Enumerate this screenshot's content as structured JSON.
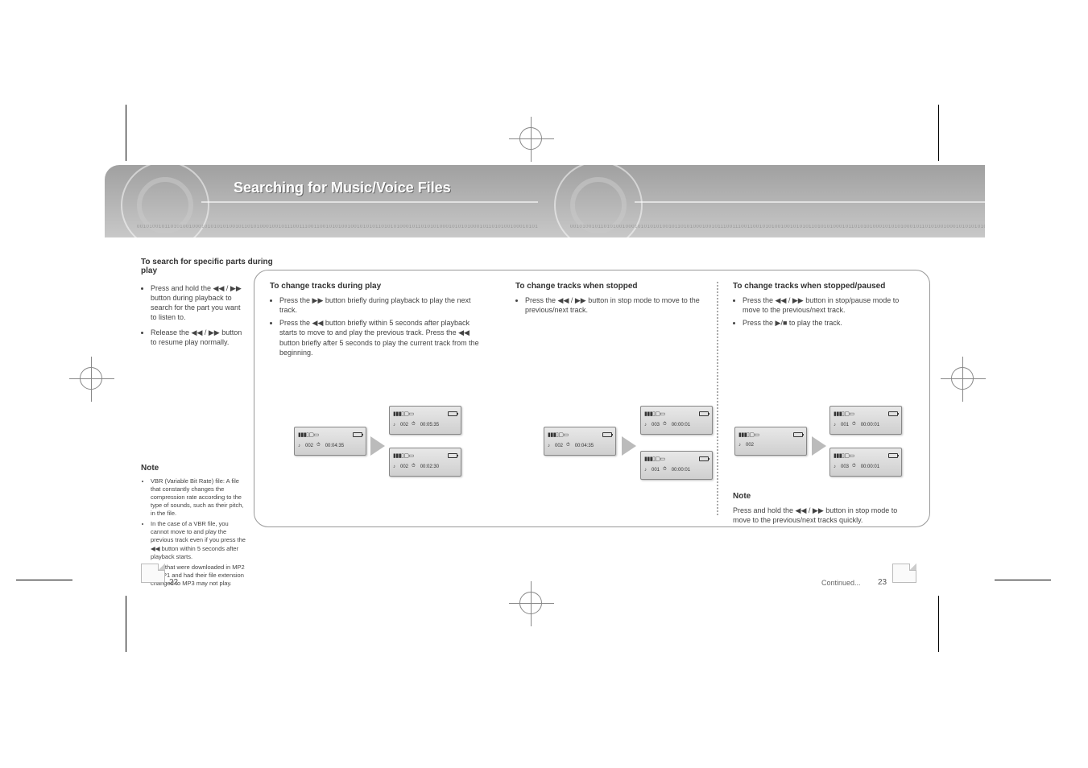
{
  "binary_string": "0010100101101010010001010101010010110101000100101110011100110010101001001010101101010100010110101010001010101000101101010010001010101010010110101000100101110011100110010101001001010101101010100010110101",
  "left": {
    "banner_title": "Searching for Music/Voice Files",
    "section1_title": "To search for specific parts during play",
    "bullet1": "Press and hold the ◀◀ / ▶▶ button during playback to search for the part you want to listen to.",
    "bullet2": "Release the ◀◀ / ▶▶ button to resume play normally.",
    "section2_title": "To change tracks during play",
    "bullet3": "Press the ▶▶ button briefly during playback to play the next track.",
    "bullet4": "Press the ◀◀ button briefly within 5 seconds after playback starts to move to and play the previous track. Press the ◀◀ button briefly after 5 seconds to play the current track from the beginning.",
    "section3_title": "To change tracks when stopped",
    "bullet5": "Press the ◀◀ / ▶▶ button in stop mode to move to the previous/next track.",
    "note_title": "Note",
    "note1": "VBR (Variable Bit Rate) file: A file that constantly changes the compression rate according to the type of sounds, such as their pitch, in the file.",
    "note2": "In the case of a VBR file, you cannot move to and play the previous track even if you press the ◀◀ button within 5 seconds after playback starts.",
    "note3": "Files that were downloaded in MP2 or MP1 and had their file extension changed to MP3 may not play."
  },
  "right": {
    "section_title": "To change tracks when stopped/paused",
    "bullet1": "Press the ◀◀ / ▶▶ button in stop/pause mode to move to the previous/next track.",
    "bullet2": "Press the ▶/■ to play the track.",
    "note_title": "Note",
    "note_text": "Press and hold the ◀◀ / ▶▶ button in stop mode to move to the previous/next tracks quickly."
  },
  "tiles": {
    "a1": {
      "track": "002",
      "time": "00:04:35"
    },
    "a2": {
      "track": "002",
      "time": "00:05:35"
    },
    "a3": {
      "track": "002",
      "time": "00:02:30"
    },
    "b1": {
      "track": "002",
      "time": "00:04:35"
    },
    "b2": {
      "track": "003",
      "time": "00:00:01"
    },
    "b3": {
      "track": "001",
      "time": "00:00:01"
    },
    "c1": {
      "track": "002",
      "time": ""
    },
    "c2": {
      "track": "001",
      "time": "00:00:01"
    },
    "c3": {
      "track": "003",
      "time": "00:00:01"
    }
  },
  "page_left": "22",
  "page_right": "23",
  "nav": "Continued..."
}
